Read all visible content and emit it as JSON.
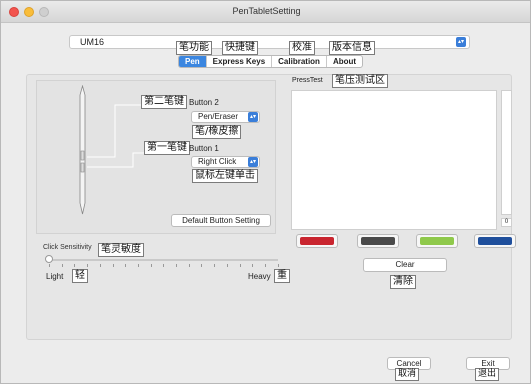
{
  "window": {
    "title": "PenTabletSetting"
  },
  "device": {
    "selected": "UM16"
  },
  "tabs": [
    {
      "label": "Pen",
      "active": true
    },
    {
      "label": "Express Keys",
      "active": false
    },
    {
      "label": "Calibration",
      "active": false
    },
    {
      "label": "About",
      "active": false
    }
  ],
  "annotations": {
    "tab_pen": "笔功能",
    "tab_express": "快捷键",
    "tab_calibration": "校准",
    "tab_about": "版本信息",
    "button2": "第二笔键",
    "button2_value": "笔/橡皮擦",
    "button1": "第一笔键",
    "button1_value": "鼠标左键单击",
    "sensitivity": "笔灵敏度",
    "light": "轻",
    "heavy": "重",
    "press_test": "笔压测试区",
    "clear": "清除",
    "cancel": "取消",
    "exit": "退出"
  },
  "pen": {
    "button2_label": "Button 2",
    "button2_value": "Pen/Eraser",
    "button1_label": "Button 1",
    "button1_value": "Right Click",
    "default_button": "Default  Button Setting"
  },
  "sensitivity": {
    "label": "Click Sensitivity",
    "light": "Light",
    "heavy": "Heavy",
    "level": 0
  },
  "press_test": {
    "label": "PressTest",
    "value": "0"
  },
  "colors": [
    {
      "name": "red",
      "hex": "#c9252f"
    },
    {
      "name": "dark-gray",
      "hex": "#4a4a4a"
    },
    {
      "name": "green",
      "hex": "#8fc94b"
    },
    {
      "name": "blue",
      "hex": "#1f4f9c"
    }
  ],
  "buttons": {
    "clear": "Clear",
    "cancel": "Cancel",
    "exit": "Exit"
  }
}
